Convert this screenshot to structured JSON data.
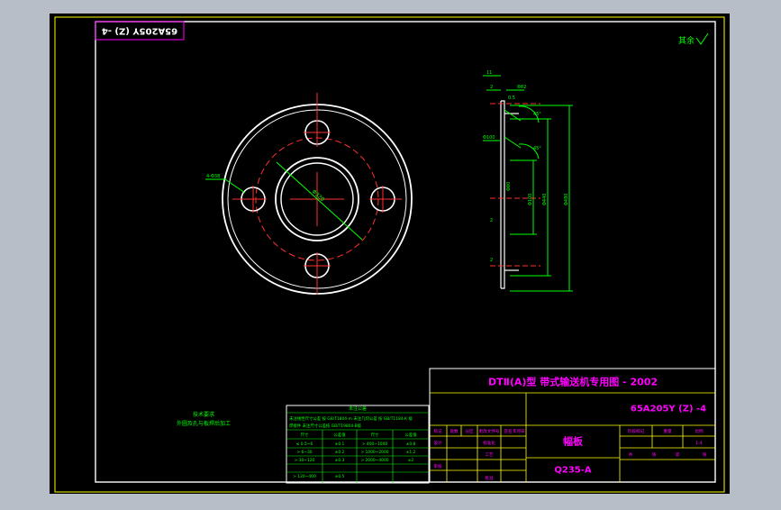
{
  "drawing": {
    "rev_stamp": "65A205Y (Z) -4",
    "roughness_note": "其余",
    "tech_note_line1": "技术要求",
    "tech_note_line2": "外圆及孔与板焊后加工",
    "hole_note": "4-Φ38",
    "dim_bolt_circle": "Φ320",
    "side_dims": [
      "11",
      "2",
      "0.5",
      "Φ82",
      "45°",
      "45°",
      "Φ100",
      "2",
      "2",
      "Φ80",
      "Φ100",
      "Φ440",
      "Φ480"
    ]
  },
  "tolerance_table": {
    "title": "未注公差",
    "note1": "未注线性尺寸公差 按 GB/T1804-m 未注几何公差 按 GB/T1184-K 级",
    "note2": "焊接件 未注尺寸公差按 GB/T19804-B级",
    "headers": [
      "尺寸",
      "公差值",
      "尺寸",
      "公差值"
    ],
    "rows": [
      [
        "≤ 0.5~6",
        "±0.1",
        "> 400~1000",
        "±0.8"
      ],
      [
        "> 6~30",
        "±0.2",
        "> 1000~2000",
        "±1.2"
      ],
      [
        "> 30~120",
        "±0.3",
        "> 2000~4000",
        "±2"
      ],
      [
        "> 120~400",
        "±0.5",
        "",
        ""
      ]
    ]
  },
  "title_block": {
    "header": "DTⅡ(A)型  带式输送机专用图 - 2002",
    "drawing_no": "65A205Y (Z) -4",
    "part_name": "幅板",
    "material": "Q235-A",
    "rev_headers": [
      "标记",
      "处数",
      "分区",
      "更改文件号",
      "签名",
      "年月日"
    ],
    "roles": [
      "设计",
      "标准化",
      "审核",
      "工艺",
      "批准"
    ],
    "right_headers": [
      "阶段标记",
      "重量",
      "比例"
    ],
    "scale": "1:4",
    "sheet": [
      "共",
      "张",
      "第",
      "张"
    ]
  }
}
